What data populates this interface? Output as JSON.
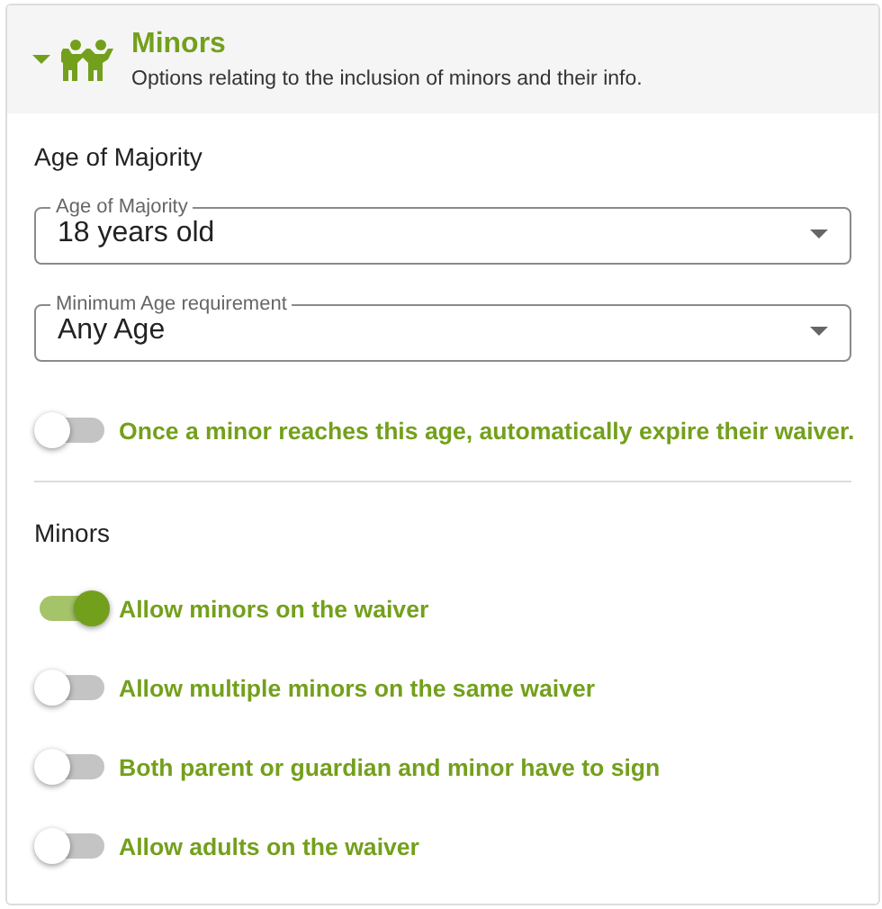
{
  "panel": {
    "title": "Minors",
    "subtitle": "Options relating to the inclusion of minors and their info.",
    "expanded": true
  },
  "sections": [
    {
      "heading": "Age of Majority",
      "items": [
        {
          "kind": "select",
          "label": "Age of Majority",
          "value": "18 years old"
        },
        {
          "kind": "select",
          "label": "Minimum Age requirement",
          "value": "Any Age"
        },
        {
          "kind": "toggle",
          "label": "Once a minor reaches this age, automatically expire their waiver.",
          "on": false
        }
      ]
    },
    {
      "heading": "Minors",
      "items": [
        {
          "kind": "toggle",
          "label": "Allow minors on the waiver",
          "on": true
        },
        {
          "kind": "toggle",
          "label": "Allow multiple minors on the same waiver",
          "on": false
        },
        {
          "kind": "toggle",
          "label": "Both parent or guardian and minor have to sign",
          "on": false
        },
        {
          "kind": "toggle",
          "label": "Allow adults on the waiver",
          "on": false
        }
      ]
    }
  ]
}
